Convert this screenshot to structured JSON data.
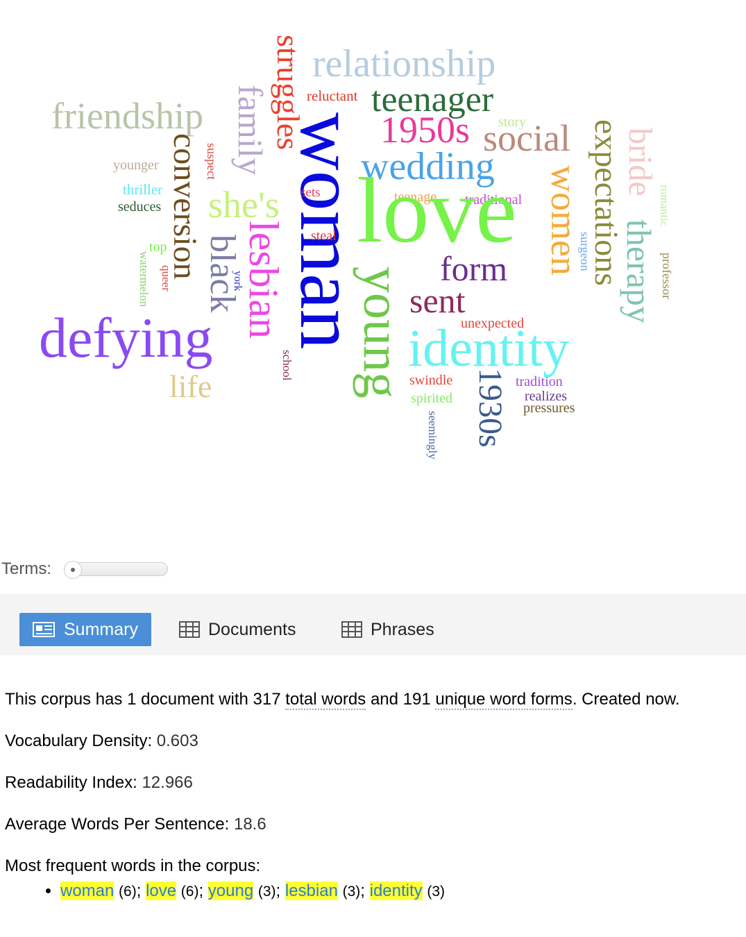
{
  "word_cloud": [
    {
      "text": "relationship",
      "color": "#b6cce0"
    },
    {
      "text": "struggles",
      "color": "#e8402f"
    },
    {
      "text": "reluctant",
      "color": "#d93a2b"
    },
    {
      "text": "teenager",
      "color": "#2d6b3a"
    },
    {
      "text": "friendship",
      "color": "#b9c4a8"
    },
    {
      "text": "family",
      "color": "#b8a6cf"
    },
    {
      "text": "1950s",
      "color": "#e8399a"
    },
    {
      "text": "story",
      "color": "#c3e58c"
    },
    {
      "text": "social",
      "color": "#bb8a7a"
    },
    {
      "text": "expectations",
      "color": "#8a8a3a"
    },
    {
      "text": "bride",
      "color": "#f4c7c7"
    },
    {
      "text": "younger",
      "color": "#b9ab98"
    },
    {
      "text": "suspect",
      "color": "#d9463a"
    },
    {
      "text": "conversion",
      "color": "#6b4e1e"
    },
    {
      "text": "woman",
      "color": "#0a0add"
    },
    {
      "text": "wedding",
      "color": "#4aa3e8"
    },
    {
      "text": "thriller",
      "color": "#5ee6f2"
    },
    {
      "text": "seduces",
      "color": "#2f5a34"
    },
    {
      "text": "sets",
      "color": "#e23b5f"
    },
    {
      "text": "teenage",
      "color": "#f2a048"
    },
    {
      "text": "traditional",
      "color": "#c24ad6"
    },
    {
      "text": "romantic",
      "color": "#b4f29a"
    },
    {
      "text": "she's",
      "color": "#c6f07a"
    },
    {
      "text": "love",
      "color": "#77f24a"
    },
    {
      "text": "women",
      "color": "#f4ab3e"
    },
    {
      "text": "therapy",
      "color": "#7fc4b2"
    },
    {
      "text": "steal",
      "color": "#e03a2e"
    },
    {
      "text": "surgeon",
      "color": "#69aae8"
    },
    {
      "text": "professor",
      "color": "#9a8a50"
    },
    {
      "text": "top",
      "color": "#7aec4a"
    },
    {
      "text": "lesbian",
      "color": "#ee47e4"
    },
    {
      "text": "black",
      "color": "#7c7ca2"
    },
    {
      "text": "watermelon",
      "color": "#8ad06a"
    },
    {
      "text": "queer",
      "color": "#e24a3a"
    },
    {
      "text": "york",
      "color": "#3030c8"
    },
    {
      "text": "form",
      "color": "#6a2f8c"
    },
    {
      "text": "young",
      "color": "#6ec84a"
    },
    {
      "text": "sent",
      "color": "#8e2a5a"
    },
    {
      "text": "unexpected",
      "color": "#e2463a"
    },
    {
      "text": "defying",
      "color": "#8a4af2"
    },
    {
      "text": "identity",
      "color": "#66f2f2"
    },
    {
      "text": "school",
      "color": "#8a2f4a"
    },
    {
      "text": "life",
      "color": "#dccb8a"
    },
    {
      "text": "swindle",
      "color": "#e2463a"
    },
    {
      "text": "1930s",
      "color": "#3a5a8c"
    },
    {
      "text": "tradition",
      "color": "#a04ae2"
    },
    {
      "text": "spirited",
      "color": "#8aea6a"
    },
    {
      "text": "realizes",
      "color": "#6a3a8c"
    },
    {
      "text": "pressures",
      "color": "#6b5a2a"
    },
    {
      "text": "seemingly",
      "color": "#4a6aa8"
    }
  ],
  "terms_label": "Terms:",
  "tabs": [
    {
      "label": "Summary"
    },
    {
      "label": "Documents"
    },
    {
      "label": "Phrases"
    }
  ],
  "summary": {
    "intro_1": "This corpus has 1 document with 317 ",
    "total_words": "total words",
    "intro_2": " and 191 ",
    "unique_word_forms": "unique word forms",
    "intro_3": ". Created now.",
    "density_label": "Vocabulary Density:",
    "density_value": "0.603",
    "readability_label": "Readability Index:",
    "readability_value": "12.966",
    "avg_label": "Average Words Per Sentence:",
    "avg_value": "18.6",
    "freq_label": "Most frequent words in the corpus:",
    "freq_words": [
      {
        "word": "woman",
        "count": "(6)"
      },
      {
        "word": "love",
        "count": "(6)"
      },
      {
        "word": "young",
        "count": "(3)"
      },
      {
        "word": "lesbian",
        "count": "(3)"
      },
      {
        "word": "identity",
        "count": "(3)"
      }
    ]
  },
  "colors": {
    "accent": "#4a8fd8",
    "highlight": "#ffff33",
    "link": "#2a7dd4"
  }
}
